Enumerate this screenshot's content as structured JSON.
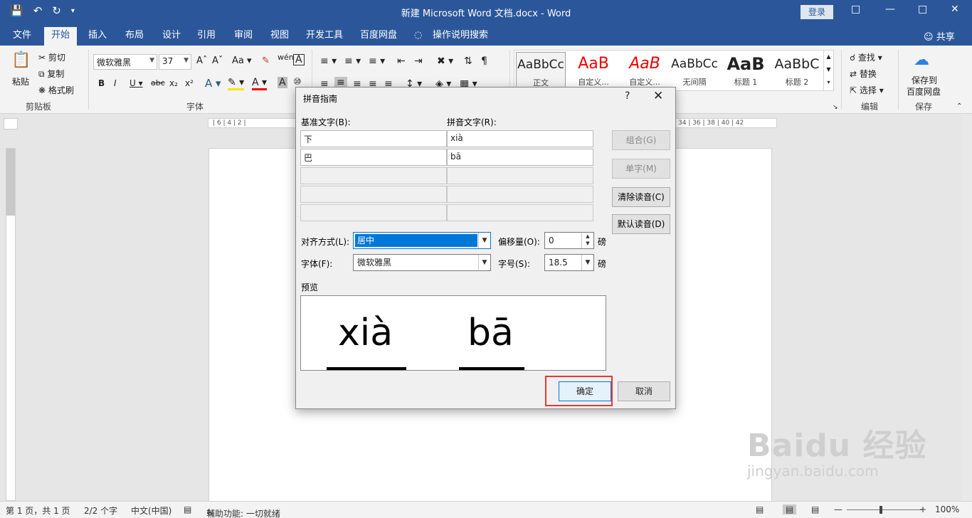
{
  "titlebar": {
    "title": "新建 Microsoft Word 文档.docx  -  Word",
    "login": "登录",
    "qat_icons": [
      "save-icon",
      "undo-icon",
      "redo-icon",
      "customize-icon"
    ]
  },
  "tabs": [
    {
      "label": "文件"
    },
    {
      "label": "开始"
    },
    {
      "label": "插入"
    },
    {
      "label": "布局"
    },
    {
      "label": "设计"
    },
    {
      "label": "引用"
    },
    {
      "label": "审阅"
    },
    {
      "label": "视图"
    },
    {
      "label": "开发工具"
    },
    {
      "label": "百度网盘"
    },
    {
      "label": "操作说明搜索"
    }
  ],
  "share": "共享",
  "ribbon": {
    "clipboard": {
      "paste": "粘贴",
      "cut": "剪切",
      "copy": "复制",
      "format_painter": "格式刷",
      "label": "剪贴板"
    },
    "font": {
      "name": "微软雅黑",
      "size": "37",
      "label": "字体"
    },
    "styles": [
      {
        "sample": "AaBbCc",
        "name": "正文"
      },
      {
        "sample": "AaB",
        "name": "自定义..."
      },
      {
        "sample": "AaB",
        "name": "自定义..."
      },
      {
        "sample": "AaBbCc",
        "name": "无间隔"
      },
      {
        "sample": "AaB",
        "name": "标题 1"
      },
      {
        "sample": "AaBbC",
        "name": "标题 2"
      }
    ],
    "editing": {
      "find": "查找",
      "replace": "替换",
      "select": "选择",
      "label": "编辑"
    },
    "save": {
      "line1": "保存到",
      "line2": "百度网盘",
      "label": "保存"
    }
  },
  "ruler": {
    "left_nums": "| 6 | 4 | 2 |",
    "right_nums": "34 | 36 | 38 | 40 | 42"
  },
  "statusbar": {
    "page": "第 1 页，共 1 页",
    "words": "2/2 个字",
    "lang": "中文(中国)",
    "accessibility": "辅助功能: 一切就绪",
    "zoom": "100%"
  },
  "dialog": {
    "title": "拼音指南",
    "help": "?",
    "base_label": "基准文字(B):",
    "ruby_label": "拼音文字(R):",
    "rows": [
      {
        "base": "下",
        "ruby": "xià"
      },
      {
        "base": "巴",
        "ruby": "bā"
      },
      {
        "base": "",
        "ruby": ""
      },
      {
        "base": "",
        "ruby": ""
      },
      {
        "base": "",
        "ruby": ""
      }
    ],
    "buttons": {
      "group": "组合(G)",
      "single": "单字(M)",
      "clear": "清除读音(C)",
      "default": "默认读音(D)"
    },
    "align_label": "对齐方式(L):",
    "align_value": "居中",
    "offset_label": "偏移量(O):",
    "offset_value": "0",
    "offset_unit": "磅",
    "font_label": "字体(F):",
    "font_value": "微软雅黑",
    "size_label": "字号(S):",
    "size_value": "18.5",
    "size_unit": "磅",
    "preview_label": "预览",
    "ok": "确定",
    "cancel": "取消"
  },
  "watermark": {
    "line1": "Baidu 经验",
    "line2": "jingyan.baidu.com"
  }
}
